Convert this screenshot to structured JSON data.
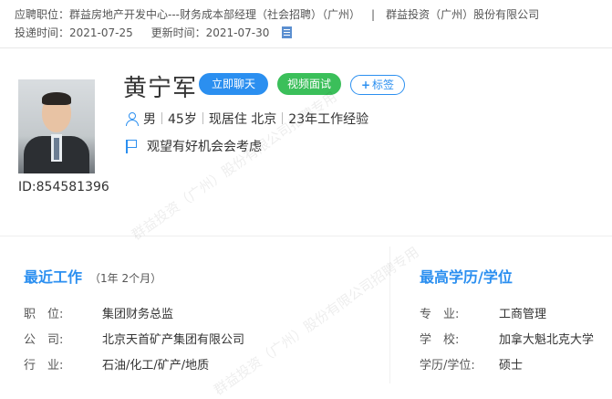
{
  "header": {
    "applied_position_label": "应聘职位：",
    "applied_position": "群益房地产开发中心---财务成本部经理（社会招聘）（广州）",
    "company": "群益投资（广州）股份有限公司",
    "delivered_label": "投递时间：",
    "delivered_date": "2021-07-25",
    "updated_label": "更新时间：",
    "updated_date": "2021-07-30"
  },
  "profile": {
    "name": "黄宁军",
    "id_text": "ID:854581396",
    "chat_button": "立即聊天",
    "video_button": "视频面试",
    "tag_button": "标签",
    "gender": "男",
    "age": "45岁",
    "residence": "现居住 北京",
    "experience": "23年工作经验",
    "job_intent": "观望有好机会会考虑"
  },
  "recent_work": {
    "title": "最近工作",
    "duration": "（1年 2个月）",
    "fields": [
      {
        "label": "职　位:",
        "value": "集团财务总监"
      },
      {
        "label": "公　司:",
        "value": "北京天首矿产集团有限公司"
      },
      {
        "label": "行　业:",
        "value": "石油/化工/矿产/地质"
      }
    ]
  },
  "education": {
    "title": "最高学历/学位",
    "fields": [
      {
        "label": "专　业:",
        "value": "工商管理"
      },
      {
        "label": "学　校:",
        "value": "加拿大魁北克大学"
      },
      {
        "label": "学历/学位:",
        "value": "硕士"
      }
    ]
  },
  "watermarks": [
    "群益投资（广州）股份有限公司招聘专用",
    "群益投资（广州）股份有限公司招聘专用"
  ],
  "colors": {
    "accent": "#2b8ff0",
    "video_green": "#3bbf5a"
  }
}
